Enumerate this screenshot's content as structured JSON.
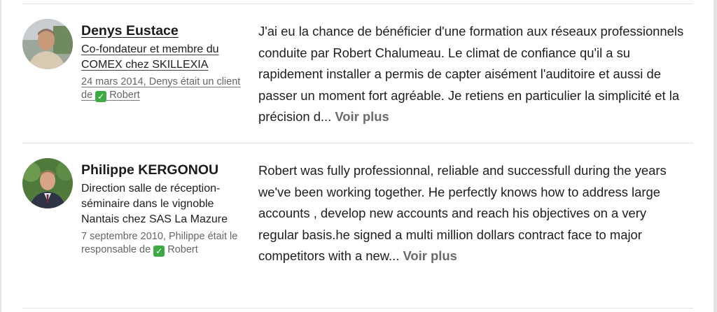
{
  "recommendations": [
    {
      "name": "Denys Eustace",
      "headline": "Co-fondateur et membre du COMEX chez SKILLEXIA",
      "meta_prefix": "24 mars 2014, Denys était un client de",
      "meta_suffix": "Robert",
      "text": "J'ai eu la chance de bénéficier d'une formation aux réseaux professionnels conduite par Robert Chalumeau. Le climat de confiance qu'il a su rapidement installer a permis de capter aisément l'auditoire et aussi de passer un moment fort agréable. Je retiens en particulier la simplicité et la précision d...",
      "more_label": "Voir plus",
      "check_icon": "check-mark-icon"
    },
    {
      "name": "Philippe KERGONOU",
      "headline": "Direction salle de réception-séminaire dans le vignoble Nantais chez SAS La Mazure",
      "meta_prefix": "7 septembre 2010, Philippe était le responsable de",
      "meta_suffix": "Robert",
      "text": "Robert was fully professionnal, reliable and successfull during the years we've been working together. He perfectly knows how to address large accounts , develop new accounts and reach his objectives on a very regular basis.he signed a multi million dollars contract face to major competitors with a new...",
      "more_label": "Voir plus",
      "check_icon": "check-mark-icon"
    }
  ]
}
